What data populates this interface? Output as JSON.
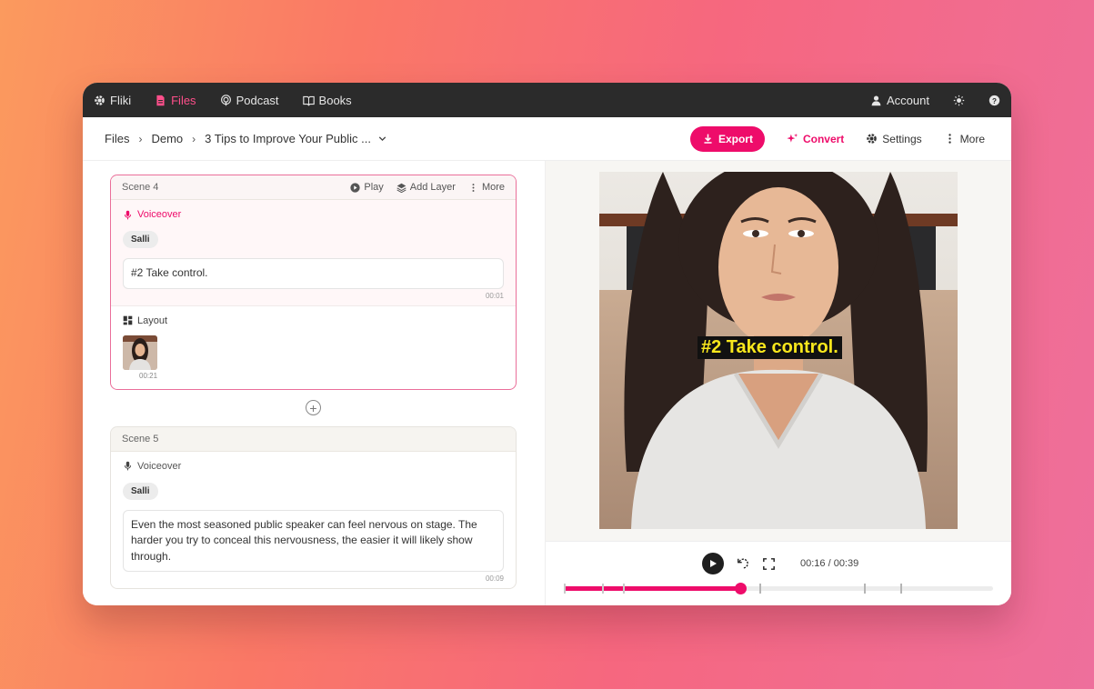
{
  "nav": {
    "brand": "Fliki",
    "items": [
      {
        "label": "Files",
        "active": true
      },
      {
        "label": "Podcast",
        "active": false
      },
      {
        "label": "Books",
        "active": false
      }
    ],
    "account": "Account"
  },
  "toolbar": {
    "crumbs": [
      "Files",
      "Demo",
      "3 Tips to Improve Your Public ..."
    ],
    "export": "Export",
    "convert": "Convert",
    "settings": "Settings",
    "more": "More"
  },
  "scenes": [
    {
      "title": "Scene 4",
      "actions": {
        "play": "Play",
        "add_layer": "Add Layer",
        "more": "More"
      },
      "voiceover_label": "Voiceover",
      "voice": "Salli",
      "text": "#2 Take control.",
      "text_duration": "00:01",
      "layout_label": "Layout",
      "layout_duration": "00:21"
    },
    {
      "title": "Scene 5",
      "voiceover_label": "Voiceover",
      "voice": "Salli",
      "text": "Even the most seasoned public speaker can feel nervous on stage. The harder you try to conceal this nervousness, the easier it will likely show through.",
      "text_duration": "00:09"
    }
  ],
  "preview": {
    "caption": "#2 Take control.",
    "time": "00:16 / 00:39",
    "progress": 0.41,
    "markers": [
      0.0,
      0.088,
      0.138,
      0.456,
      0.7,
      0.784
    ]
  },
  "colors": {
    "accent": "#ee0c6a",
    "caption_text": "#f8e71c"
  }
}
